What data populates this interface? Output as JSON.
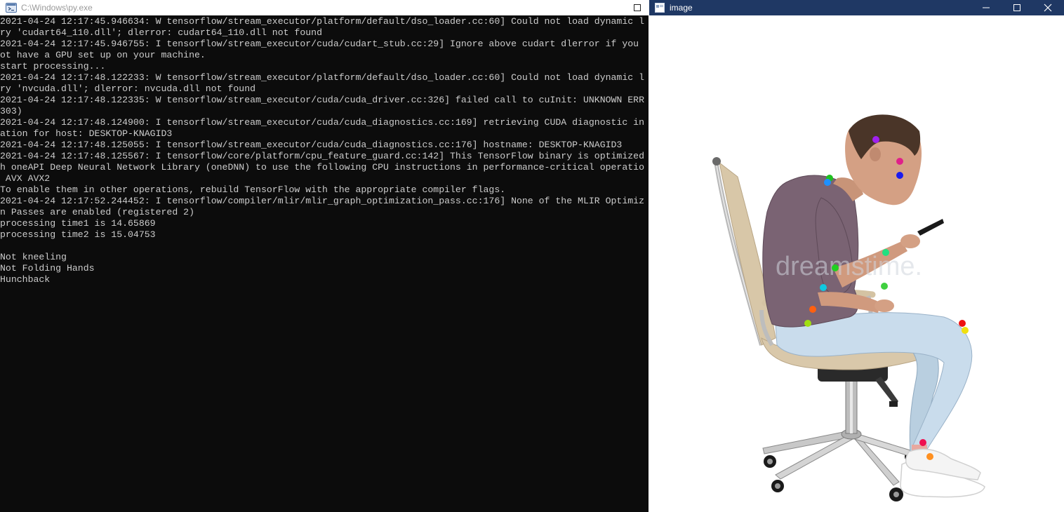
{
  "console_window": {
    "title": "C:\\Windows\\py.exe",
    "lines": [
      "2021-04-24 12:17:45.946634: W tensorflow/stream_executor/platform/default/dso_loader.cc:60] Could not load dynamic l",
      "ry 'cudart64_110.dll'; dlerror: cudart64_110.dll not found",
      "2021-04-24 12:17:45.946755: I tensorflow/stream_executor/cuda/cudart_stub.cc:29] Ignore above cudart dlerror if you",
      "ot have a GPU set up on your machine.",
      "start processing...",
      "2021-04-24 12:17:48.122233: W tensorflow/stream_executor/platform/default/dso_loader.cc:60] Could not load dynamic l",
      "ry 'nvcuda.dll'; dlerror: nvcuda.dll not found",
      "2021-04-24 12:17:48.122335: W tensorflow/stream_executor/cuda/cuda_driver.cc:326] failed call to cuInit: UNKNOWN ERR",
      "303)",
      "2021-04-24 12:17:48.124900: I tensorflow/stream_executor/cuda/cuda_diagnostics.cc:169] retrieving CUDA diagnostic in",
      "ation for host: DESKTOP-KNAGID3",
      "2021-04-24 12:17:48.125055: I tensorflow/stream_executor/cuda/cuda_diagnostics.cc:176] hostname: DESKTOP-KNAGID3",
      "2021-04-24 12:17:48.125567: I tensorflow/core/platform/cpu_feature_guard.cc:142] This TensorFlow binary is optimized",
      "h oneAPI Deep Neural Network Library (oneDNN) to use the following CPU instructions in performance-critical operatio",
      " AVX AVX2",
      "To enable them in other operations, rebuild TensorFlow with the appropriate compiler flags.",
      "2021-04-24 12:17:52.244452: I tensorflow/compiler/mlir/mlir_graph_optimization_pass.cc:176] None of the MLIR Optimiz",
      "n Passes are enabled (registered 2)",
      "processing time1 is 14.65869",
      "processing time2 is 15.04753",
      "",
      "Not kneeling",
      "Not Folding Hands",
      "Hunchback"
    ]
  },
  "image_window": {
    "title": "image",
    "watermark": "dreamstime.",
    "keypoint_colors": {
      "ear": "#a020f0",
      "eye": "#e0208a",
      "nose": "#1a1aee",
      "shoulder_a": "#20c020",
      "shoulder_b": "#1e90ff",
      "elbow_a": "#20d020",
      "elbow_b": "#10c8e0",
      "wrist_a": "#20e080",
      "wrist_b": "#40d040",
      "hip_a": "#ff6010",
      "hip_b": "#a0e010",
      "knee_a": "#ee1010",
      "knee_b": "#f0e010",
      "ankle_a": "#ee1050",
      "ankle_b": "#ff9020"
    }
  },
  "icons": {
    "console_app": "python-console-icon",
    "image_app": "image-window-icon",
    "minimize": "minimize-icon",
    "maximize": "maximize-icon",
    "close": "close-icon"
  }
}
